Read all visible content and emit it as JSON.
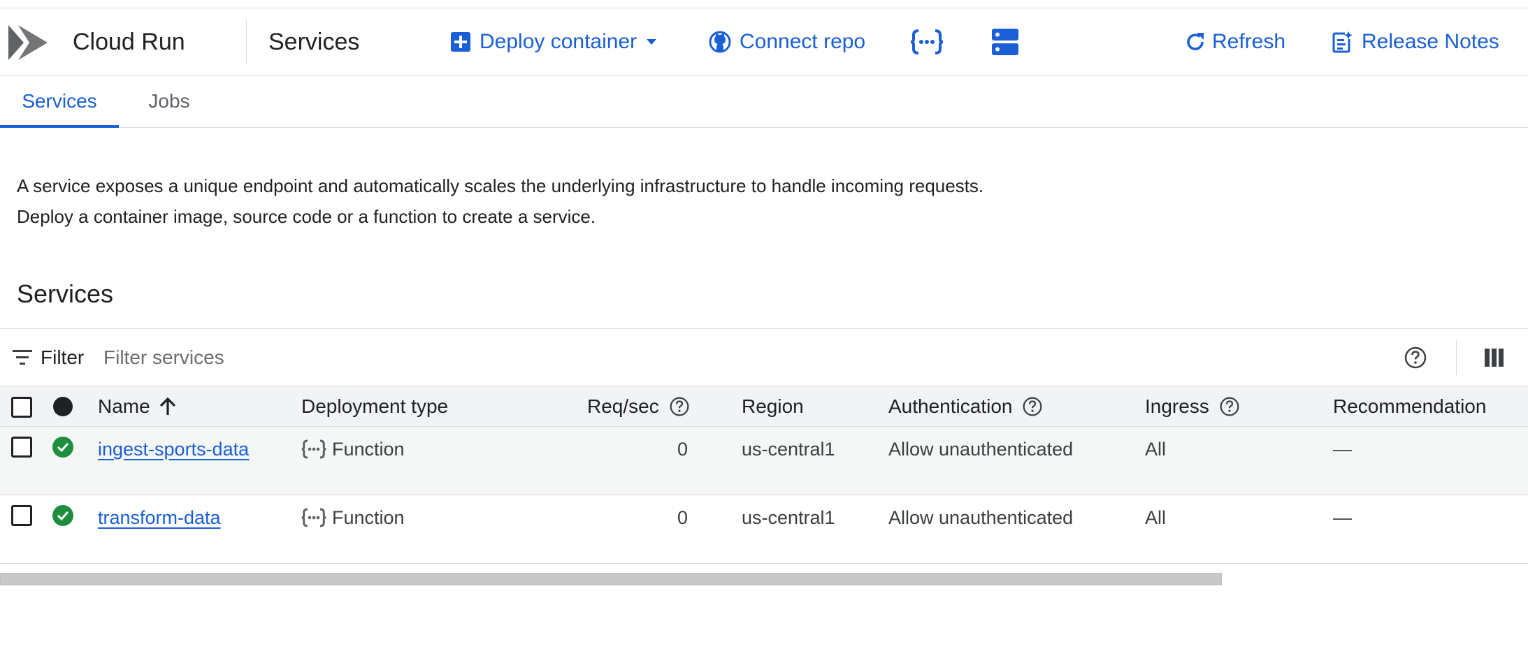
{
  "header": {
    "product_name": "Cloud Run",
    "page_title": "Services",
    "actions": {
      "deploy_container": "Deploy container",
      "connect_repo": "Connect repo",
      "refresh": "Refresh",
      "release_notes": "Release Notes"
    }
  },
  "tabs": [
    {
      "label": "Services",
      "active": true
    },
    {
      "label": "Jobs",
      "active": false
    }
  ],
  "description": {
    "line1": "A service exposes a unique endpoint and automatically scales the underlying infrastructure to handle incoming requests.",
    "line2": "Deploy a container image, source code or a function to create a service."
  },
  "section_title": "Services",
  "filter": {
    "label": "Filter",
    "placeholder": "Filter services"
  },
  "table": {
    "columns": {
      "name": "Name",
      "deployment_type": "Deployment type",
      "req_sec": "Req/sec",
      "region": "Region",
      "authentication": "Authentication",
      "ingress": "Ingress",
      "recommendation": "Recommendation"
    },
    "rows": [
      {
        "name": "ingest-sports-data",
        "deployment_type": "Function",
        "req_sec": "0",
        "region": "us-central1",
        "authentication": "Allow unauthenticated",
        "ingress": "All",
        "recommendation": "—"
      },
      {
        "name": "transform-data",
        "deployment_type": "Function",
        "req_sec": "0",
        "region": "us-central1",
        "authentication": "Allow unauthenticated",
        "ingress": "All",
        "recommendation": "—"
      }
    ]
  },
  "colors": {
    "accent": "#1a5fd6",
    "status_ok": "#1e8e3e",
    "header_bg": "#f1f3f4",
    "row_highlight": "#f5f6f6",
    "divider": "#dadce0"
  },
  "icons": {
    "logo": "cloud-run-logo",
    "deploy": "add-box-icon",
    "deploy_menu": "caret-down-icon",
    "connect_repo": "github-icon",
    "function": "function-icon",
    "yaml": "yaml-list-icon",
    "refresh": "refresh-icon",
    "release_notes": "release-notes-icon",
    "filter": "filter-icon",
    "help": "help-icon",
    "columns": "column-display-icon",
    "sort": "arrow-up-icon",
    "status": "check-circle-icon"
  }
}
